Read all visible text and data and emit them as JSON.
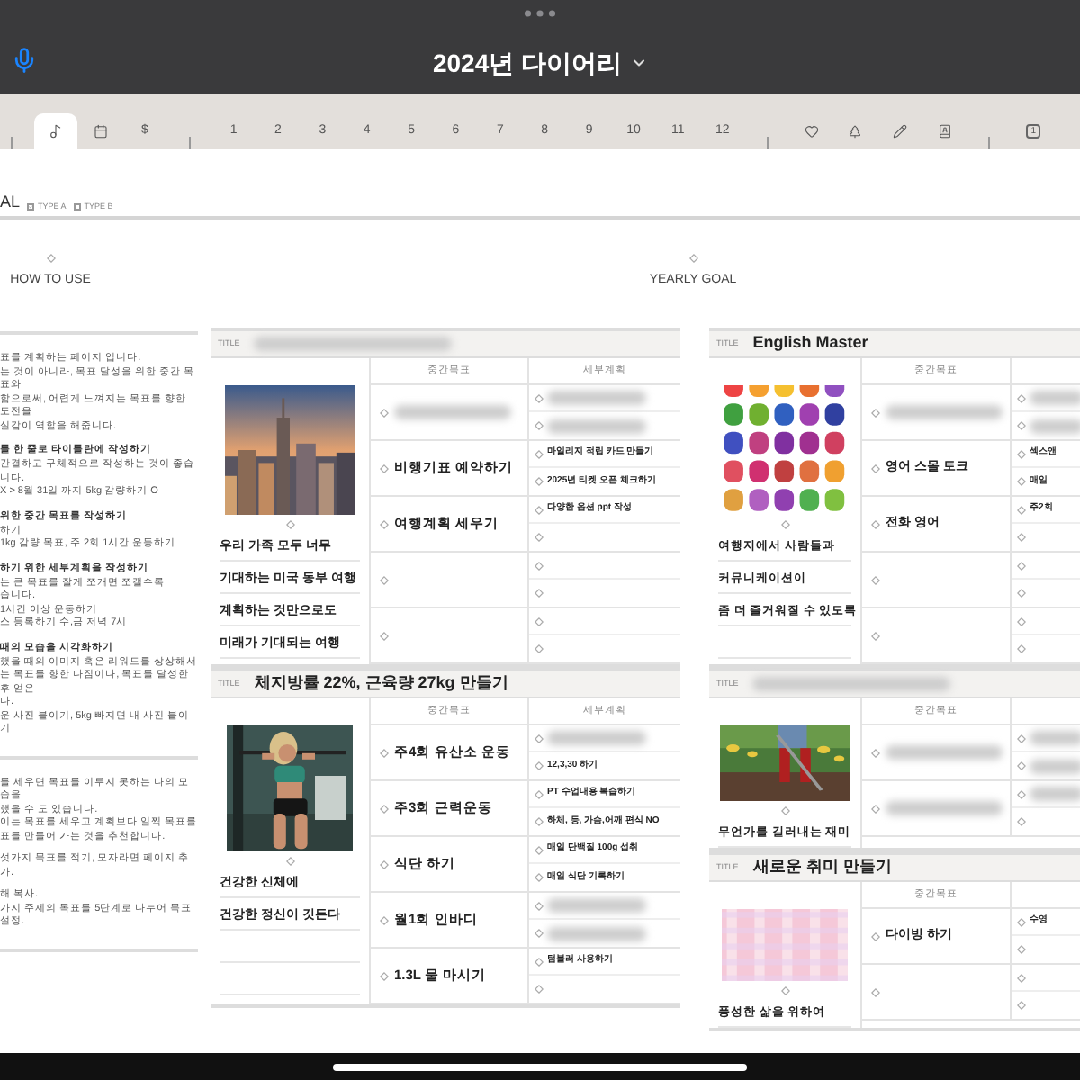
{
  "window": {
    "title": "2024년 다이어리"
  },
  "tab_groups": [
    [
      {
        "kind": "note",
        "selected": true
      },
      {
        "kind": "calendar",
        "selected": false
      },
      {
        "kind": "text",
        "label": "$",
        "selected": false
      }
    ],
    [
      {
        "kind": "text",
        "label": "1",
        "selected": false
      },
      {
        "kind": "text",
        "label": "2",
        "selected": false
      },
      {
        "kind": "text",
        "label": "3",
        "selected": false
      },
      {
        "kind": "text",
        "label": "4",
        "selected": false
      },
      {
        "kind": "text",
        "label": "5",
        "selected": false
      },
      {
        "kind": "text",
        "label": "6",
        "selected": false
      },
      {
        "kind": "text",
        "label": "7",
        "selected": false
      },
      {
        "kind": "text",
        "label": "8",
        "selected": false
      },
      {
        "kind": "text",
        "label": "9",
        "selected": false
      },
      {
        "kind": "text",
        "label": "10",
        "selected": false
      },
      {
        "kind": "text",
        "label": "11",
        "selected": false
      },
      {
        "kind": "text",
        "label": "12",
        "selected": false
      }
    ],
    [
      {
        "kind": "heart",
        "selected": false
      },
      {
        "kind": "tree",
        "selected": false
      },
      {
        "kind": "pen",
        "selected": false
      },
      {
        "kind": "book",
        "selected": false
      }
    ],
    [
      {
        "kind": "badge",
        "label": "1",
        "selected": false
      }
    ]
  ],
  "page_title": "AL",
  "options": [
    {
      "label": "TYPE A",
      "checked": true
    },
    {
      "label": "TYPE B",
      "checked": false
    }
  ],
  "how_to_use": {
    "title": "HOW TO USE",
    "parts": [
      {
        "sections": [
          {
            "lines": [
              "표를 계획하는 페이지 입니다.",
              "는 것이 아니라, 목표 달성을 위한 중간 목표와",
              "함으로써, 어렵게 느껴지는 목표를 향한 도전을",
              "실감이 역할을 해줍니다."
            ]
          },
          {
            "heading": "를 한 줄로 타이틀란에 작성하기",
            "lines": [
              "간결하고 구체적으로 작성하는 것이 좋습니다.",
              "X > 8월 31일 까지 5kg 감량하기 O"
            ]
          },
          {
            "heading": "위한 중간 목표를 작성하기",
            "lines": [
              "하기",
              "1kg 감량 목표, 주 2회 1시간 운동하기"
            ]
          },
          {
            "heading": "하기 위한 세부계획을 작성하기",
            "lines": [
              "는 큰 목표를 잘게 쪼개면 쪼갤수록",
              "습니다.",
              "1시간 이상 운동하기",
              "스 등록하기 수,금 저녁 7시"
            ]
          },
          {
            "heading": "때의 모습을 시각화하기",
            "lines": [
              "했을 때의 이미지 혹은 리워드를 상상해서",
              "는 목표를 향한 다짐이나, 목표를 달성한 후 얻은",
              "다.",
              "운 사진 붙이기, 5kg 빠지면 내 사진 붙이기"
            ]
          }
        ]
      },
      {
        "sections": [
          {
            "lines": [
              "를 세우면 목표를 이루지 못하는 나의 모습을",
              "했을 수 도 있습니다.",
              "이는 목표를 세우고 계획보다 일찍 목표를",
              "표를 만들어 가는 것을 추천합니다."
            ]
          },
          {
            "lines": [
              "섯가지 목표를 적기, 모자라면 페이지 추가."
            ]
          },
          {
            "lines": [
              "해 복사.",
              "가지 주제의 목표를 5단계로 나누어 목표 설정."
            ]
          }
        ]
      }
    ]
  },
  "yearly_goal": {
    "title": "YEARLY GOAL",
    "columns": [
      {
        "cards": [
          {
            "title_label": "TITLE",
            "title_blurred": true,
            "picture": {
              "kind": "city"
            },
            "headers": [
              "중간목표",
              "세부계획"
            ],
            "captions": [
              "우리 가족 모두 너무",
              "기대하는 미국 동부 여행",
              "계획하는 것만으로도",
              "미래가 기대되는 여행"
            ],
            "goals": [
              {
                "kind": "goal",
                "blurred": true,
                "plans": [
                  {
                    "blurred": true
                  },
                  {
                    "blurred": true
                  }
                ]
              },
              {
                "kind": "goal",
                "text": "비행기표 예약하기",
                "plans": [
                  {
                    "text": "마일리지 적립 카드 만들기"
                  },
                  {
                    "text": "2025년 티켓 오픈 체크하기"
                  }
                ]
              },
              {
                "kind": "goal",
                "text": "여행계획 세우기",
                "plans": [
                  {
                    "text": "다양한 옵션 ppt 작성"
                  }
                ]
              },
              {
                "kind": "blank"
              },
              {
                "kind": "blank"
              }
            ]
          },
          {
            "title_label": "TITLE",
            "title": "체지방률 22%, 근육량 27kg 만들기",
            "picture": {
              "kind": "fitness"
            },
            "headers": [
              "중간목표",
              "세부계획"
            ],
            "captions": [
              "건강한 신체에",
              "건강한 정신이 깃든다"
            ],
            "goals": [
              {
                "kind": "goal",
                "text": "주4회 유산소 운동",
                "plans": [
                  {
                    "blurred": true
                  },
                  {
                    "text": "12,3,30 하기"
                  }
                ]
              },
              {
                "kind": "goal",
                "text": "주3회 근력운동",
                "plans": [
                  {
                    "text": "PT 수업내용 복습하기"
                  },
                  {
                    "text": "하체, 등, 가슴,어깨 편식 NO"
                  }
                ]
              },
              {
                "kind": "goal",
                "text": "식단 하기",
                "plans": [
                  {
                    "text": "매일 단백질 100g 섭취"
                  },
                  {
                    "text": "매일 식단 기록하기"
                  }
                ]
              },
              {
                "kind": "goal",
                "text": "월1회 인바디",
                "plans": [
                  {
                    "blurred": true
                  },
                  {
                    "blurred": true
                  }
                ]
              },
              {
                "kind": "goal",
                "text": "1.3L 물 마시기",
                "plans": [
                  {
                    "text": "텀블러 사용하기"
                  }
                ]
              }
            ]
          }
        ]
      },
      {
        "cards": [
          {
            "title_label": "TITLE",
            "title": "English Master",
            "picture": {
              "kind": "letters"
            },
            "headers": [
              "중간목표"
            ],
            "captions": [
              "여행지에서 사람들과",
              "커뮤니케이션이",
              "좀 더 즐거워질 수 있도록"
            ],
            "goals": [
              {
                "kind": "goal",
                "blurred": true,
                "plans": [
                  {
                    "blurred": true
                  },
                  {
                    "blurred": true
                  }
                ]
              },
              {
                "kind": "goal",
                "text": "영어 스몰 토크",
                "plans": [
                  {
                    "text": "섹스앤"
                  },
                  {
                    "text": "매일"
                  }
                ]
              },
              {
                "kind": "goal",
                "text": "전화 영어",
                "plans": [
                  {
                    "text": "주2회"
                  }
                ]
              },
              {
                "kind": "blank"
              },
              {
                "kind": "blank"
              }
            ]
          },
          {
            "title_label": "TITLE",
            "title_blurred": true,
            "picture": {
              "kind": "garden"
            },
            "headers": [
              "중간목표"
            ],
            "captions": [
              "무언가를 길러내는 재미"
            ],
            "goals": [
              {
                "kind": "goal",
                "blurred": true,
                "plans": [
                  {
                    "blurred": true
                  },
                  {
                    "blurred": true
                  }
                ]
              },
              {
                "kind": "goal",
                "blurred": true,
                "plans": [
                  {
                    "blurred": true
                  }
                ]
              }
            ]
          },
          {
            "title_label": "TITLE",
            "title": "새로운 취미 만들기",
            "picture": {
              "kind": "plaid"
            },
            "headers": [
              "중간목표"
            ],
            "captions": [
              "풍성한 삶을 위하여"
            ],
            "goals": [
              {
                "kind": "goal",
                "text": "다이빙 하기",
                "plans": [
                  {
                    "text": "수영"
                  }
                ]
              },
              {
                "kind": "blank"
              }
            ]
          }
        ]
      }
    ]
  }
}
